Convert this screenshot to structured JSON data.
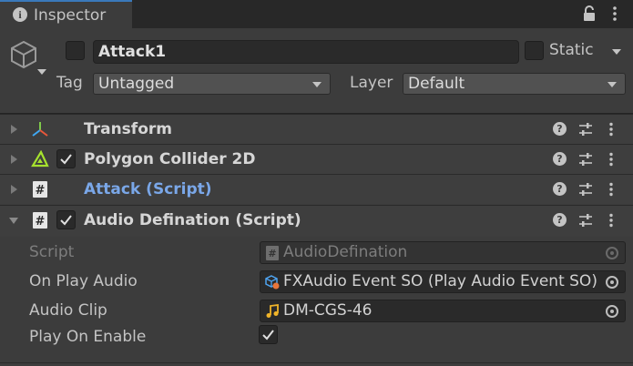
{
  "tab": {
    "title": "Inspector"
  },
  "header": {
    "name": "Attack1",
    "static_label": "Static",
    "tag_label": "Tag",
    "tag_value": "Untagged",
    "layer_label": "Layer",
    "layer_value": "Default"
  },
  "components": [
    {
      "name": "Transform",
      "icon": "transform-icon",
      "has_checkbox": false,
      "expanded": false
    },
    {
      "name": "Polygon Collider 2D",
      "icon": "polygon-collider-icon",
      "has_checkbox": true,
      "checked": true,
      "expanded": false
    },
    {
      "name": "Attack (Script)",
      "icon": "script-icon",
      "has_checkbox": false,
      "expanded": false,
      "missing_highlight": true
    },
    {
      "name": "Audio Defination (Script)",
      "icon": "script-icon",
      "has_checkbox": true,
      "checked": true,
      "expanded": true
    }
  ],
  "properties": {
    "script_label": "Script",
    "script_value": "AudioDefination",
    "on_play_audio_label": "On Play Audio",
    "on_play_audio_value": "FXAudio Event SO (Play Audio Event SO)",
    "audio_clip_label": "Audio Clip",
    "audio_clip_value": "DM-CGS-46",
    "play_on_enable_label": "Play On Enable",
    "play_on_enable_checked": true
  },
  "colors": {
    "accent_tab": "#3a79bb",
    "link_text": "#7aa7e8",
    "collider_green": "#a6e22e",
    "audio_yellow": "#f0b429"
  }
}
